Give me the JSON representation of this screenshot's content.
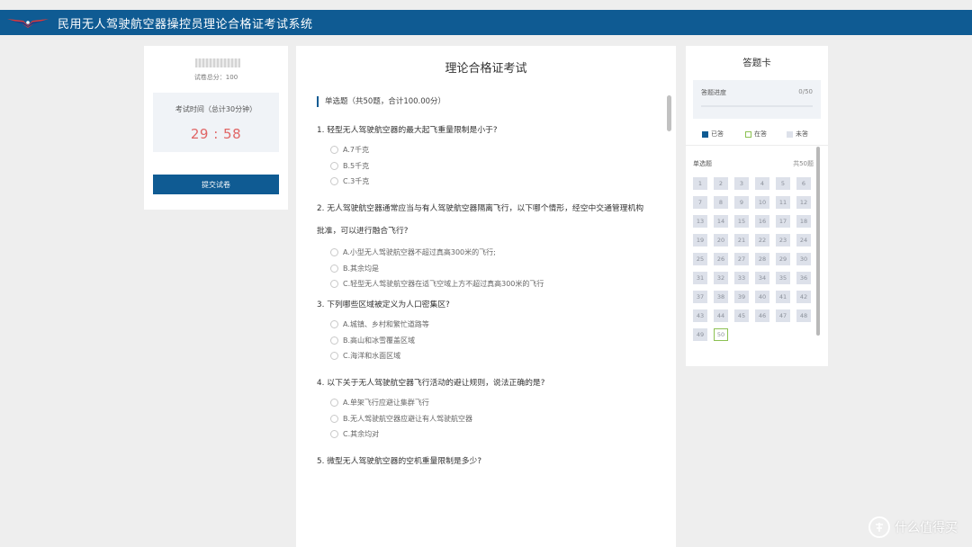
{
  "header": {
    "title": "民用无人驾驶航空器操控员理论合格证考试系统",
    "bar_color": "#0f5b93"
  },
  "left": {
    "score_label": "试卷总分：100",
    "timer_label": "考试时间（总计30分钟）",
    "timer_value": "29 : 58",
    "submit_label": "提交试卷"
  },
  "exam": {
    "title": "理论合格证考试",
    "section": "单选题（共50题，合计100.00分）",
    "questions": [
      {
        "text": "1. 轻型无人驾驶航空器的最大起飞重量限制是小于?",
        "options": [
          "A.7千克",
          "B.5千克",
          "C.3千克"
        ]
      },
      {
        "text_line1": "2. 无人驾驶航空器通常应当与有人驾驶航空器隔离飞行，以下哪个情形，经空中交通管理机构",
        "text_line2": "批准，可以进行融合飞行?",
        "options": [
          "A.小型无人驾驶航空器不超过真高300米的飞行;",
          "B.其余均是",
          "C.轻型无人驾驶航空器在适飞空域上方不超过真高300米的飞行"
        ]
      },
      {
        "text": "3. 下列哪些区域被定义为人口密集区?",
        "options": [
          "A.城镇、乡村和繁忙道路等",
          "B.高山和冰雪覆盖区域",
          "C.海洋和水面区域"
        ]
      },
      {
        "text": "4. 以下关于无人驾驶航空器飞行活动的避让规则，说法正确的是?",
        "options": [
          "A.单架飞行应避让集群飞行",
          "B.无人驾驶航空器应避让有人驾驶航空器",
          "C.其余均对"
        ]
      },
      {
        "text": "5. 微型无人驾驶航空器的空机重量限制是多少?"
      }
    ]
  },
  "card": {
    "title": "答题卡",
    "progress_label": "答题进度",
    "progress_count": "0/50",
    "progress_fraction": 0,
    "legend": {
      "answered": "已答",
      "current": "在答",
      "unanswered": "未答"
    },
    "section_label": "单选题",
    "section_count": "共50题",
    "numbers": [
      "1",
      "2",
      "3",
      "4",
      "5",
      "6",
      "7",
      "8",
      "9",
      "10",
      "11",
      "12",
      "13",
      "14",
      "15",
      "16",
      "17",
      "18",
      "19",
      "20",
      "21",
      "22",
      "23",
      "24",
      "25",
      "26",
      "27",
      "28",
      "29",
      "30",
      "31",
      "32",
      "33",
      "34",
      "35",
      "36",
      "37",
      "38",
      "39",
      "40",
      "41",
      "42",
      "43",
      "44",
      "45",
      "46",
      "47",
      "48",
      "49",
      "50"
    ],
    "current_number": "50",
    "colors": {
      "answered": "#0f5b93",
      "current": "#8cc152",
      "unanswered": "#dde1ea"
    }
  },
  "watermark": {
    "text": "什么值得买"
  }
}
